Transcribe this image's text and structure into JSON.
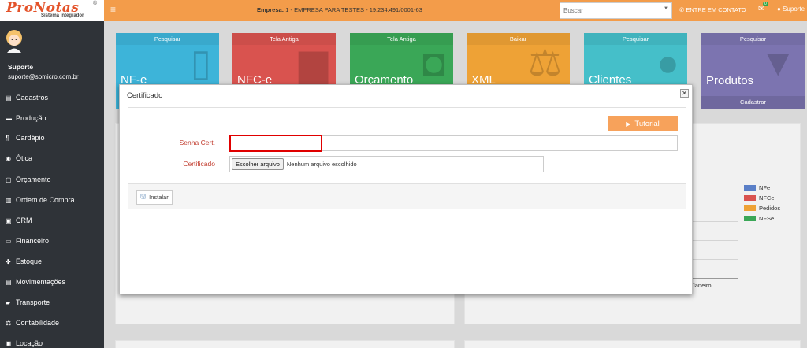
{
  "header": {
    "logo_text": "ProNotas",
    "logo_registered": "®",
    "logo_subtitle": "Sistema Integrador",
    "menu_icon": "≡",
    "company_label": "Empresa:",
    "company_value": " 1 - EMPRESA PARA TESTES - 19.234.491/0001-63",
    "search_placeholder": "Buscar",
    "contact_label": "ENTRE EM CONTATO",
    "messages_count": "0",
    "user_label": "Suporte"
  },
  "sidebar": {
    "user_name": "Suporte",
    "user_email": "suporte@somicro.com.br",
    "items": [
      {
        "label": "Cadastros",
        "icon": "▤"
      },
      {
        "label": "Produção",
        "icon": "▬"
      },
      {
        "label": "Cardápio",
        "icon": "¶"
      },
      {
        "label": "Ótica",
        "icon": "◉"
      },
      {
        "label": "Orçamento",
        "icon": "▢"
      },
      {
        "label": "Ordem de Compra",
        "icon": "▥"
      },
      {
        "label": "CRM",
        "icon": "▣"
      },
      {
        "label": "Financeiro",
        "icon": "▭"
      },
      {
        "label": "Estoque",
        "icon": "✤"
      },
      {
        "label": "Movimentações",
        "icon": "▤"
      },
      {
        "label": "Transporte",
        "icon": "▰"
      },
      {
        "label": "Contabilidade",
        "icon": "⚖"
      },
      {
        "label": "Locação",
        "icon": "▣"
      }
    ]
  },
  "tiles": [
    {
      "header": "Pesquisar",
      "label": "NF-e",
      "color": "#3db4d9",
      "icon": "▯"
    },
    {
      "header": "Tela Antiga",
      "label": "NFC-e",
      "color": "#d9534f",
      "icon": "▆"
    },
    {
      "header": "Tela Antiga",
      "label": "Orçamento",
      "color": "#3aa757",
      "icon": "◘"
    },
    {
      "header": "Baixar",
      "label": "XML",
      "color": "#eea236",
      "icon": "⚖"
    },
    {
      "header": "Pesquisar",
      "label": "Clientes",
      "color": "#45bfc9",
      "icon": "●"
    },
    {
      "header": "Pesquisar",
      "label": "Produtos",
      "color": "#7c74b0",
      "icon": "▼",
      "footer": "Cadastrar"
    }
  ],
  "chart_legend": [
    {
      "name": "NFe",
      "color": "#5a7fc7"
    },
    {
      "name": "NFCe",
      "color": "#d9534f"
    },
    {
      "name": "Pedidos",
      "color": "#eea236"
    },
    {
      "name": "NFSe",
      "color": "#3aa757"
    }
  ],
  "chart_month": "Janeiro",
  "modal": {
    "title": "Certificado",
    "close_icon": "✕",
    "tutorial_label": "Tutorial",
    "tutorial_icon": "▶",
    "password_label": "Senha Cert.",
    "password_value": "",
    "certificate_label": "Certificado",
    "file_button_label": "Escolher arquivo",
    "file_status": "Nenhum arquivo escolhido",
    "install_label": "Instalar",
    "install_icon": "🖫"
  }
}
